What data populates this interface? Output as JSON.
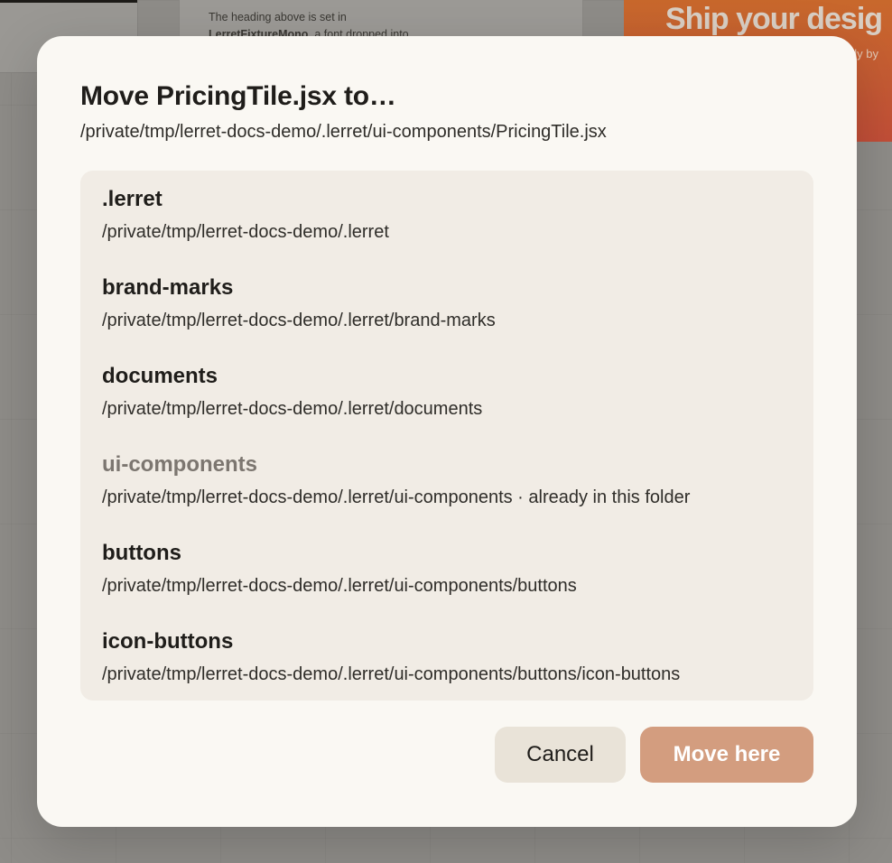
{
  "background": {
    "doc_card_text_prefix": "The heading above is set in",
    "doc_card_font_name": "LerretFixtureMono",
    "doc_card_text_suffix": ", a font dropped into",
    "promo_heading": "Ship your desig",
    "promo_sub": "ely by"
  },
  "modal": {
    "title": "Move PricingTile.jsx to…",
    "subtitle": "/private/tmp/lerret-docs-demo/.lerret/ui-components/PricingTile.jsx",
    "folders": [
      {
        "name": ".lerret",
        "path": "/private/tmp/lerret-docs-demo/.lerret",
        "current": false
      },
      {
        "name": "brand-marks",
        "path": "/private/tmp/lerret-docs-demo/.lerret/brand-marks",
        "current": false
      },
      {
        "name": "documents",
        "path": "/private/tmp/lerret-docs-demo/.lerret/documents",
        "current": false
      },
      {
        "name": "ui-components",
        "path": "/private/tmp/lerret-docs-demo/.lerret/ui-components · already in this folder",
        "current": true
      },
      {
        "name": "buttons",
        "path": "/private/tmp/lerret-docs-demo/.lerret/ui-components/buttons",
        "current": false
      },
      {
        "name": "icon-buttons",
        "path": "/private/tmp/lerret-docs-demo/.lerret/ui-components/buttons/icon-buttons",
        "current": false
      }
    ],
    "cancel_label": "Cancel",
    "move_label": "Move here"
  },
  "colors": {
    "accent": "#d39d7f",
    "modal_bg": "#faf8f3",
    "list_bg": "#f1ece5",
    "cancel_bg": "#e9e3d8",
    "disabled_text": "#7c7670"
  }
}
